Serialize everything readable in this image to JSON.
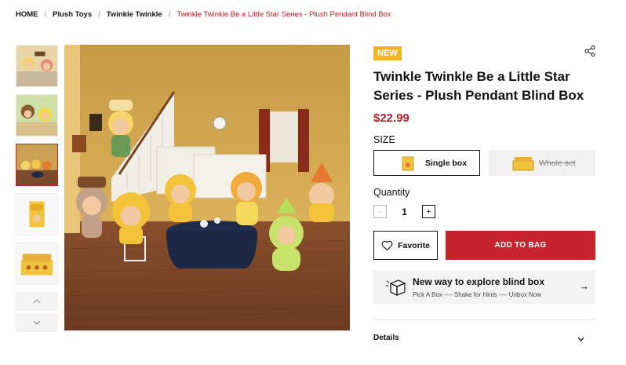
{
  "breadcrumb": {
    "items": [
      "HOME",
      "Plush Toys",
      "Twinkle Twinkle"
    ],
    "current": "Twinkle Twinkle Be a Little Star Series - Plush Pendant Blind Box",
    "separator": "/"
  },
  "gallery": {
    "thumbnail_count": 5,
    "active_index": 2,
    "nav_up_icon": "chevron-up-icon",
    "nav_down_icon": "chevron-down-icon"
  },
  "product": {
    "badge": "NEW",
    "title": "Twinkle Twinkle Be a Little Star Series - Plush Pendant Blind Box",
    "price": "$22.99",
    "share_icon": "share-icon"
  },
  "size": {
    "label": "SIZE",
    "options": [
      {
        "label": "Single box",
        "selected": true,
        "available": true
      },
      {
        "label": "Whole set",
        "selected": false,
        "available": false
      }
    ]
  },
  "quantity": {
    "label": "Quantity",
    "value": "1",
    "minus": "-",
    "plus": "+"
  },
  "actions": {
    "favorite_label": "Favorite",
    "add_to_bag_label": "ADD TO BAG"
  },
  "explore": {
    "title": "New way to explore blind box",
    "subtitle": "Pick A Box ---- Shake for Hints ---- Unbox Now",
    "arrow": "→"
  },
  "details": {
    "label": "Details"
  },
  "colors": {
    "accent_red": "#c7252d",
    "price_red": "#b8222b",
    "badge_yellow": "#f0b429"
  }
}
